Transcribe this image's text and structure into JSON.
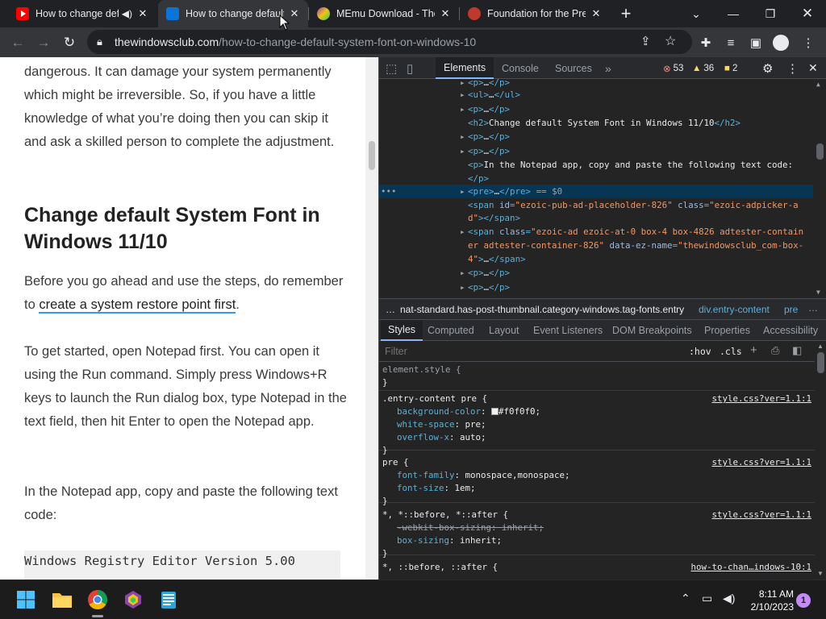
{
  "browser": {
    "tabs": [
      {
        "title": "How to change default"
      },
      {
        "title": "How to change default"
      },
      {
        "title": "MEmu Download - The"
      },
      {
        "title": "Foundation for the Pre"
      }
    ],
    "new_tab": "+",
    "url_domain": "thewindowsclub.com",
    "url_path": "/how-to-change-default-system-font-on-windows-10"
  },
  "page": {
    "para1": "dangerous. It can damage your system permanently which might be irreversible. So, if you have a little knowledge of what you’re doing then you can skip it and ask a skilled person to complete the adjustment.",
    "heading": "Change default System Font in Windows 11/10",
    "para2_prefix": "Before you go ahead and use the steps, do remember to ",
    "para2_link": "create a system restore point first",
    "para2_suffix": ".",
    "para3": "To get started, open Notepad first. You can open it using the Run command. Simply press Windows+R keys to launch the Run dialog box, type Notepad in the text field, then hit Enter to open the Notepad app.",
    "para4": "In the Notepad app, copy and paste the following text code:",
    "code": "Windows Registry Editor Version 5.00"
  },
  "devtools": {
    "tabs": [
      "Elements",
      "Console",
      "Sources"
    ],
    "more": "»",
    "errors": "53",
    "warnings": "36",
    "issues": "2",
    "dom": {
      "p1": "…",
      "ul": "…",
      "p2": "…",
      "h2_text": "Change default System Font in Windows 11/10",
      "p3": "…",
      "p4": "…",
      "p5_text": "In the Notepad app, copy and paste the following text code:",
      "pre_text": "…",
      "pre_marker": "== $0",
      "span1_id": "ezoic-pub-ad-placeholder-826",
      "span1_class_a": "ezoic-adpicker-a",
      "span1_class_b": "d",
      "span2_class_a": "ezoic-ad ezoic-at-0 box-4 box-4826 adtester-contain",
      "span2_class_b": "er adtester-container-826",
      "span2_ezname_a": "thewindowsclub_com-box-",
      "span2_ezname_b": "4",
      "p6": "…",
      "p7": "…",
      "ellipsis": "•••"
    },
    "breadcrumbs": {
      "more": "…",
      "c1": "nat-standard.has-post-thumbnail.category-windows.tag-fonts.entry",
      "c2": "div.entry-content",
      "c3": "pre"
    },
    "style_tabs": [
      "Styles",
      "Computed",
      "Layout",
      "Event Listeners",
      "DOM Breakpoints",
      "Properties",
      "Accessibility"
    ],
    "filter_placeholder": "Filter",
    "hov": ":hov",
    "cls": ".cls",
    "rules": {
      "r0_selector": "element.style {",
      "r1_selector": ".entry-content pre {",
      "r1_source": "style.css?ver=1.1:1",
      "r1_p1": "background-color",
      "r1_v1": "#f0f0f0;",
      "r1_p2": "white-space",
      "r1_v2": "pre;",
      "r1_p3": "overflow-x",
      "r1_v3": "auto;",
      "r2_selector": "pre {",
      "r2_source": "style.css?ver=1.1:1",
      "r2_p1": "font-family",
      "r2_v1": "monospace,monospace;",
      "r2_p2": "font-size",
      "r2_v2": "1em;",
      "r3_selector": "*, *::before, *::after {",
      "r3_source": "style.css?ver=1.1:1",
      "r3_p1": "-webkit-box-sizing",
      "r3_v1": "inherit;",
      "r3_p2": "box-sizing",
      "r3_v2": "inherit;",
      "r4_selector": "*, ::before, ::after {",
      "r4_source": "how-to-chan…indows-10:1",
      "close": "}"
    },
    "swatch_color": "#f0f0f0"
  },
  "taskbar": {
    "time": "8:11 AM",
    "date": "2/10/2023",
    "notifications": "1"
  },
  "colors": {
    "link_underline": "#2a9df4",
    "error": "#f28b82",
    "warning": "#fdd663"
  }
}
